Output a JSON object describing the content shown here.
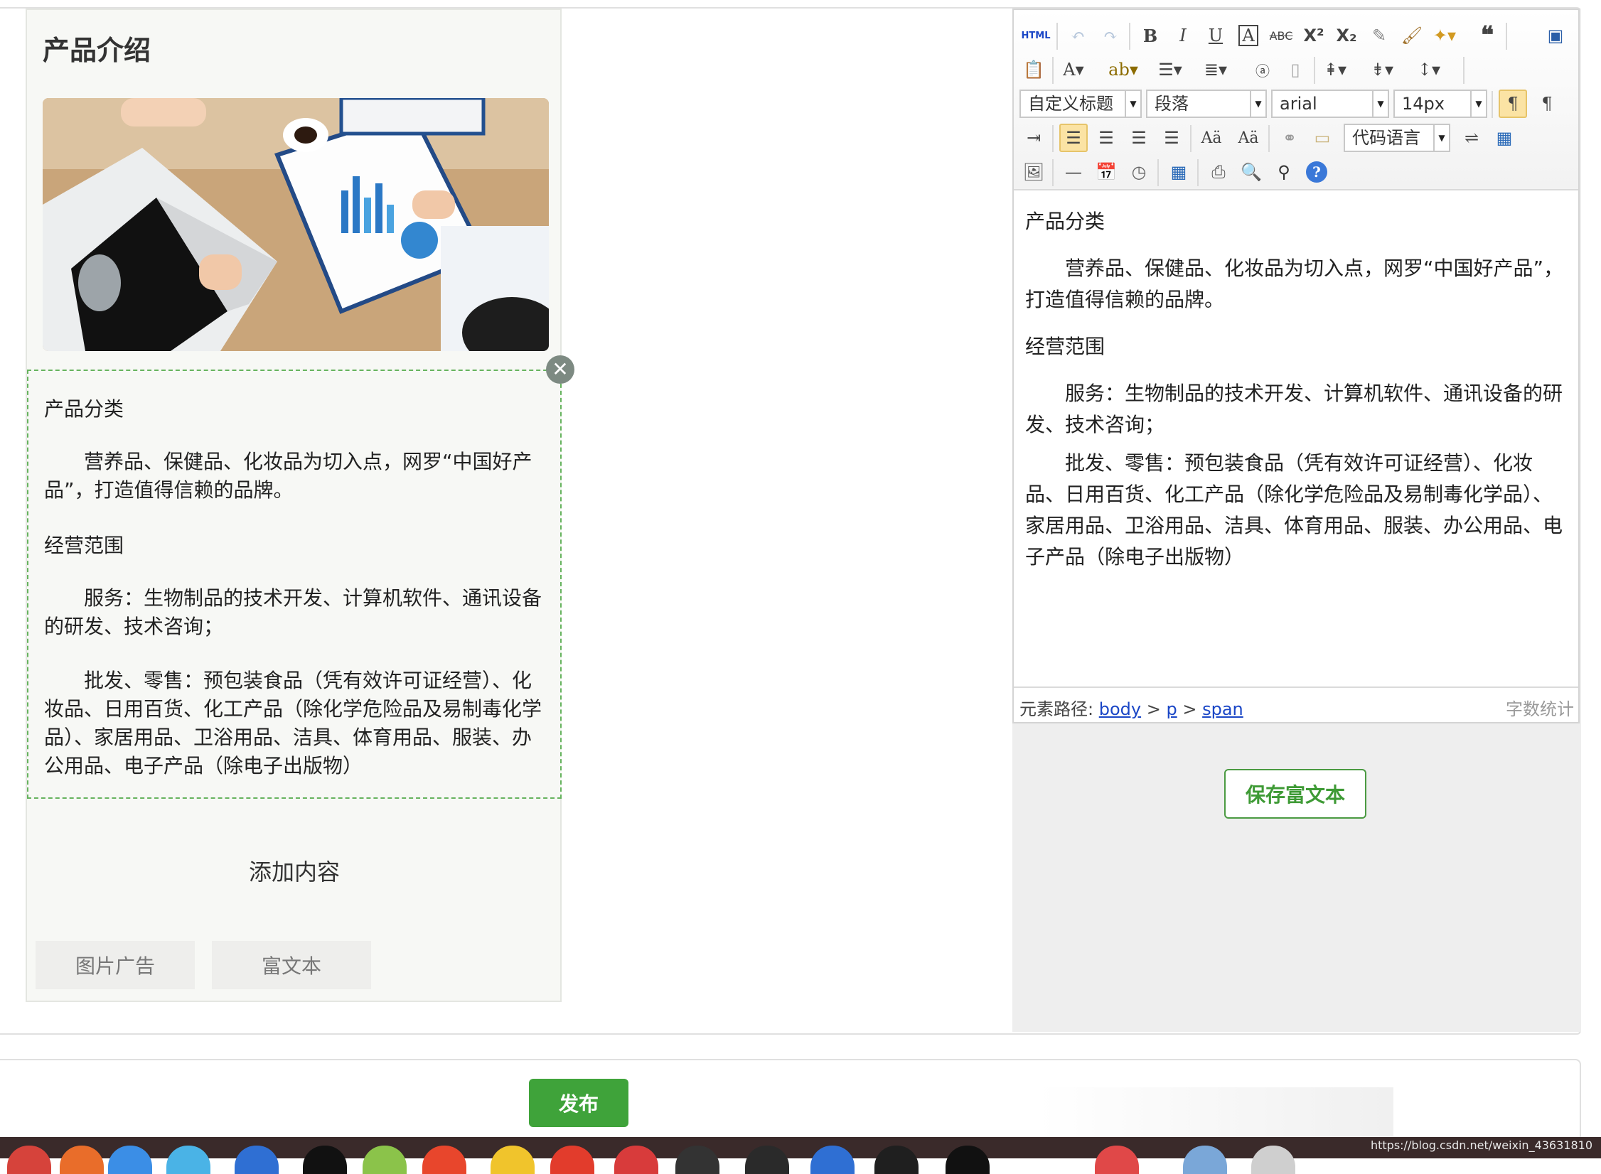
{
  "preview": {
    "title": "产品介绍",
    "rich_paragraphs": [
      "产品分类",
      "　　营养品、保健品、化妆品为切入点，网罗“中国好产品”，打造值得信赖的品牌。",
      "经营范围",
      "　　服务：生物制品的技术开发、计算机软件、通讯设备的研发、技术咨询；",
      "　　批发、零售：预包装食品（凭有效许可证经营）、化妆品、日用百货、化工产品（除化学危险品及易制毒化学品）、家居用品、卫浴用品、洁具、体育用品、服装、办公用品、电子产品（除电子出版物）"
    ],
    "close_symbol": "✕",
    "add_content_label": "添加内容",
    "add_buttons": [
      "图片广告",
      "富文本"
    ]
  },
  "editor": {
    "toolbar": {
      "html_label": "HTML",
      "bold": "B",
      "italic": "I",
      "underline": "U",
      "superscript": "X²",
      "subscript": "X₂",
      "custom_heading": "自定义标题",
      "paragraph": "段落",
      "font_family": "arial",
      "font_size": "14px",
      "code_language": "代码语言"
    },
    "paragraphs": [
      "产品分类",
      "　　营养品、保健品、化妆品为切入点，网罗“中国好产品”，打造值得信赖的品牌。",
      "经营范围",
      "　　服务：生物制品的技术开发、计算机软件、通讯设备的研发、技术咨询；",
      "　　批发、零售：预包装食品（凭有效许可证经营）、化妆品、日用百货、化工产品（除化学危险品及易制毒化学品）、家居用品、卫浴用品、洁具、体育用品、服装、办公用品、电子产品（除电子出版物）"
    ],
    "status": {
      "path_label": "元素路径:",
      "path": [
        "body",
        "p",
        "span"
      ],
      "separator": ">",
      "word_count": "字数统计"
    },
    "save_label": "保存富文本"
  },
  "publish_label": "发布",
  "watermark": "https://blog.csdn.net/weixin_43631810",
  "colors": {
    "accent_green": "#3fa33a",
    "link_blue": "#1a46c6"
  }
}
